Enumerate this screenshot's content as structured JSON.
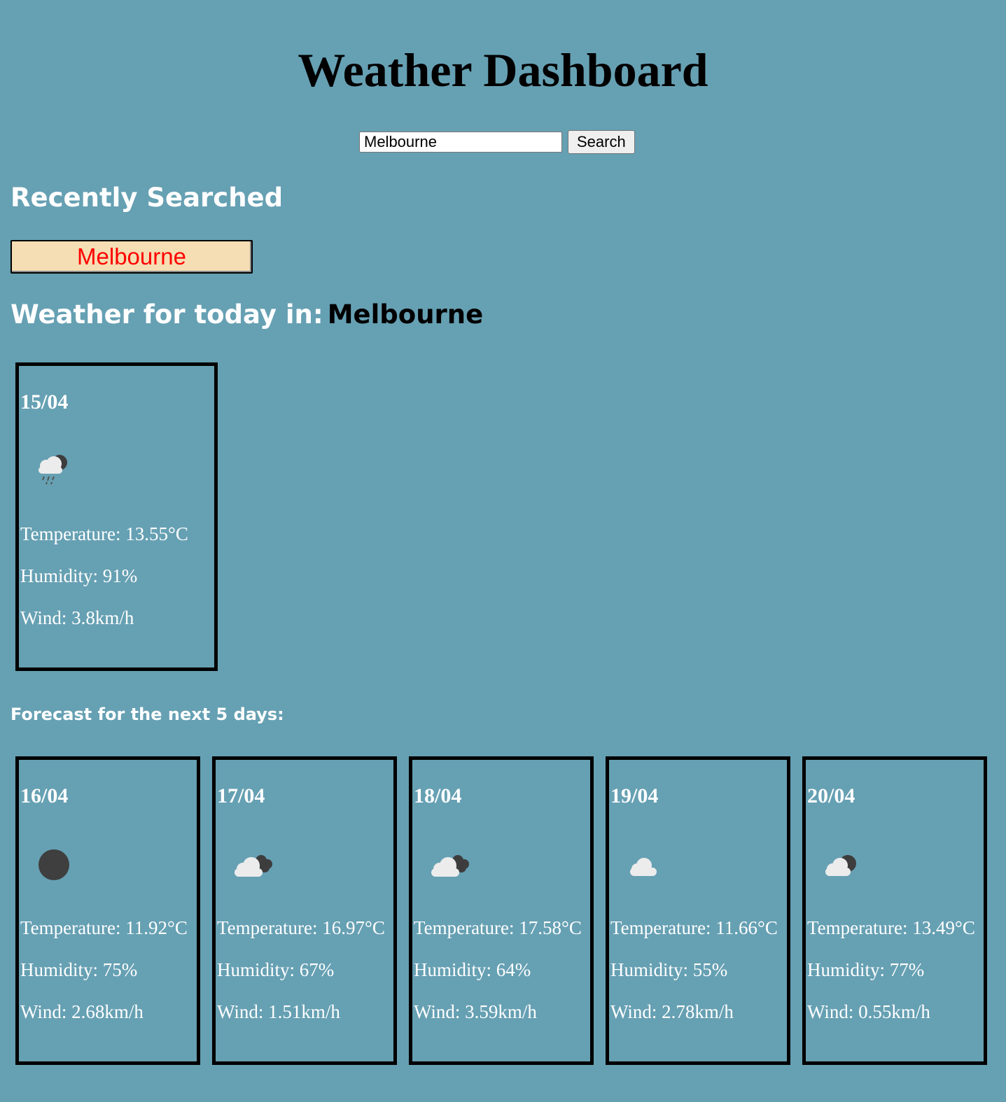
{
  "title": "Weather Dashboard",
  "search": {
    "value": "Melbourne",
    "button_label": "Search"
  },
  "recent": {
    "heading": "Recently Searched",
    "items": [
      "Melbourne"
    ]
  },
  "today": {
    "heading": "Weather for today in:",
    "city": "Melbourne",
    "date": "15/04",
    "icon": "rain-night-icon",
    "temperature": "Temperature: 13.55°C",
    "humidity": "Humidity: 91%",
    "wind": "Wind: 3.8km/h"
  },
  "forecast": {
    "heading": "Forecast for the next 5 days:",
    "days": [
      {
        "date": "16/04",
        "icon": "clear-night-icon",
        "temperature": "Temperature: 11.92°C",
        "humidity": "Humidity: 75%",
        "wind": "Wind: 2.68km/h"
      },
      {
        "date": "17/04",
        "icon": "broken-clouds-icon",
        "temperature": "Temperature: 16.97°C",
        "humidity": "Humidity: 67%",
        "wind": "Wind: 1.51km/h"
      },
      {
        "date": "18/04",
        "icon": "broken-clouds-icon",
        "temperature": "Temperature: 17.58°C",
        "humidity": "Humidity: 64%",
        "wind": "Wind: 3.59km/h"
      },
      {
        "date": "19/04",
        "icon": "cloud-icon",
        "temperature": "Temperature: 11.66°C",
        "humidity": "Humidity: 55%",
        "wind": "Wind: 2.78km/h"
      },
      {
        "date": "20/04",
        "icon": "few-clouds-night-icon",
        "temperature": "Temperature: 13.49°C",
        "humidity": "Humidity: 77%",
        "wind": "Wind: 0.55km/h"
      }
    ]
  }
}
